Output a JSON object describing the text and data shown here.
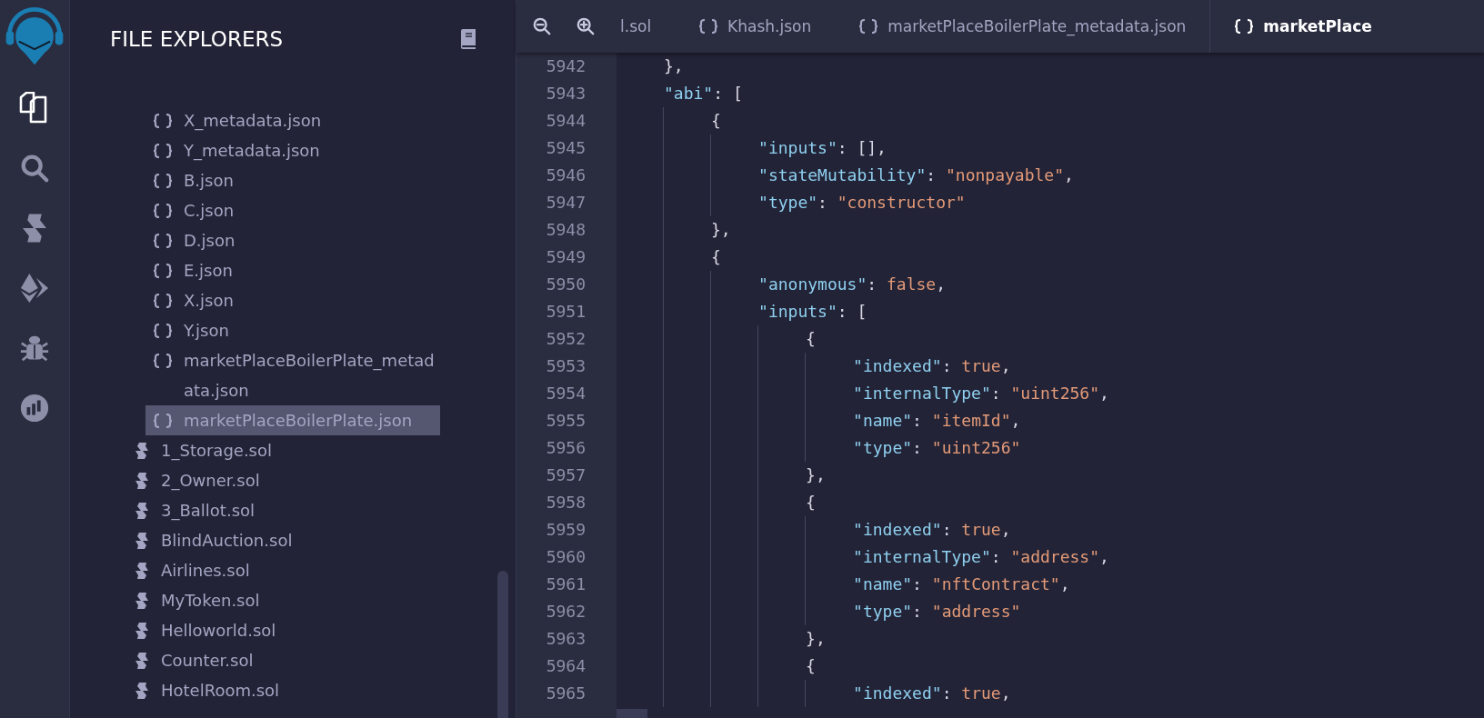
{
  "activity_bar": [
    {
      "kind": "files",
      "selected": true
    },
    {
      "kind": "search",
      "selected": false
    },
    {
      "kind": "solidity",
      "selected": false
    },
    {
      "kind": "deploy",
      "selected": false
    },
    {
      "kind": "debug",
      "selected": false
    },
    {
      "kind": "analytics",
      "selected": false
    }
  ],
  "sidebar": {
    "title": "FILE EXPLORERS",
    "artifact_files": [
      {
        "name": "X_metadata.json",
        "kind": "json",
        "selected": false
      },
      {
        "name": "Y_metadata.json",
        "kind": "json",
        "selected": false
      },
      {
        "name": "B.json",
        "kind": "json",
        "selected": false
      },
      {
        "name": "C.json",
        "kind": "json",
        "selected": false
      },
      {
        "name": "D.json",
        "kind": "json",
        "selected": false
      },
      {
        "name": "E.json",
        "kind": "json",
        "selected": false
      },
      {
        "name": "X.json",
        "kind": "json",
        "selected": false
      },
      {
        "name": "Y.json",
        "kind": "json",
        "selected": false
      },
      {
        "name": "marketPlaceBoilerPlate_metadata.json",
        "kind": "json",
        "selected": false
      },
      {
        "name": "marketPlaceBoilerPlate.json",
        "kind": "json",
        "selected": true
      }
    ],
    "files": [
      {
        "name": "1_Storage.sol",
        "kind": "sol",
        "selected": false
      },
      {
        "name": "2_Owner.sol",
        "kind": "sol",
        "selected": false
      },
      {
        "name": "3_Ballot.sol",
        "kind": "sol",
        "selected": false
      },
      {
        "name": "BlindAuction.sol",
        "kind": "sol",
        "selected": false
      },
      {
        "name": "Airlines.sol",
        "kind": "sol",
        "selected": false
      },
      {
        "name": "MyToken.sol",
        "kind": "sol",
        "selected": false
      },
      {
        "name": "Helloworld.sol",
        "kind": "sol",
        "selected": false
      },
      {
        "name": "Counter.sol",
        "kind": "sol",
        "selected": false
      },
      {
        "name": "HotelRoom.sol",
        "kind": "sol",
        "selected": false
      }
    ]
  },
  "tabs": [
    {
      "label": "l.sol",
      "kind": "sol",
      "selected": false
    },
    {
      "label": "Khash.json",
      "kind": "json",
      "selected": false
    },
    {
      "label": "marketPlaceBoilerPlate_metadata.json",
      "kind": "json",
      "selected": false
    },
    {
      "label": "marketPlace",
      "kind": "json",
      "selected": true
    }
  ],
  "editor": {
    "lines": [
      {
        "num": "5942",
        "tokens": [
          {
            "kind": "punct",
            "text": "},"
          }
        ]
      },
      {
        "num": "5943",
        "tokens": [
          {
            "kind": "key",
            "text": "\"abi\""
          },
          {
            "kind": "punct",
            "text": ": ["
          }
        ],
        "children": [
          {
            "num": "5944",
            "tokens": [
              {
                "kind": "punct",
                "text": "{"
              }
            ],
            "children": [
              {
                "num": "5945",
                "tokens": [
                  {
                    "kind": "key",
                    "text": "\"inputs\""
                  },
                  {
                    "kind": "punct",
                    "text": ": [],"
                  }
                ]
              },
              {
                "num": "5946",
                "tokens": [
                  {
                    "kind": "key",
                    "text": "\"stateMutability\""
                  },
                  {
                    "kind": "punct",
                    "text": ": "
                  },
                  {
                    "kind": "string",
                    "text": "\"nonpayable\""
                  },
                  {
                    "kind": "punct",
                    "text": ","
                  }
                ]
              },
              {
                "num": "5947",
                "tokens": [
                  {
                    "kind": "key",
                    "text": "\"type\""
                  },
                  {
                    "kind": "punct",
                    "text": ": "
                  },
                  {
                    "kind": "string",
                    "text": "\"constructor\""
                  }
                ]
              }
            ]
          },
          {
            "num": "5948",
            "tokens": [
              {
                "kind": "punct",
                "text": "},"
              }
            ]
          },
          {
            "num": "5949",
            "tokens": [
              {
                "kind": "punct",
                "text": "{"
              }
            ],
            "children": [
              {
                "num": "5950",
                "tokens": [
                  {
                    "kind": "key",
                    "text": "\"anonymous\""
                  },
                  {
                    "kind": "punct",
                    "text": ": "
                  },
                  {
                    "kind": "literal",
                    "text": "false"
                  },
                  {
                    "kind": "punct",
                    "text": ","
                  }
                ]
              },
              {
                "num": "5951",
                "tokens": [
                  {
                    "kind": "key",
                    "text": "\"inputs\""
                  },
                  {
                    "kind": "punct",
                    "text": ": ["
                  }
                ],
                "children": [
                  {
                    "num": "5952",
                    "tokens": [
                      {
                        "kind": "punct",
                        "text": "{"
                      }
                    ],
                    "children": [
                      {
                        "num": "5953",
                        "tokens": [
                          {
                            "kind": "key",
                            "text": "\"indexed\""
                          },
                          {
                            "kind": "punct",
                            "text": ": "
                          },
                          {
                            "kind": "literal",
                            "text": "true"
                          },
                          {
                            "kind": "punct",
                            "text": ","
                          }
                        ]
                      },
                      {
                        "num": "5954",
                        "tokens": [
                          {
                            "kind": "key",
                            "text": "\"internalType\""
                          },
                          {
                            "kind": "punct",
                            "text": ": "
                          },
                          {
                            "kind": "string",
                            "text": "\"uint256\""
                          },
                          {
                            "kind": "punct",
                            "text": ","
                          }
                        ]
                      },
                      {
                        "num": "5955",
                        "tokens": [
                          {
                            "kind": "key",
                            "text": "\"name\""
                          },
                          {
                            "kind": "punct",
                            "text": ": "
                          },
                          {
                            "kind": "string",
                            "text": "\"itemId\""
                          },
                          {
                            "kind": "punct",
                            "text": ","
                          }
                        ]
                      },
                      {
                        "num": "5956",
                        "tokens": [
                          {
                            "kind": "key",
                            "text": "\"type\""
                          },
                          {
                            "kind": "punct",
                            "text": ": "
                          },
                          {
                            "kind": "string",
                            "text": "\"uint256\""
                          }
                        ]
                      }
                    ]
                  },
                  {
                    "num": "5957",
                    "tokens": [
                      {
                        "kind": "punct",
                        "text": "},"
                      }
                    ]
                  },
                  {
                    "num": "5958",
                    "tokens": [
                      {
                        "kind": "punct",
                        "text": "{"
                      }
                    ],
                    "children": [
                      {
                        "num": "5959",
                        "tokens": [
                          {
                            "kind": "key",
                            "text": "\"indexed\""
                          },
                          {
                            "kind": "punct",
                            "text": ": "
                          },
                          {
                            "kind": "literal",
                            "text": "true"
                          },
                          {
                            "kind": "punct",
                            "text": ","
                          }
                        ]
                      },
                      {
                        "num": "5960",
                        "tokens": [
                          {
                            "kind": "key",
                            "text": "\"internalType\""
                          },
                          {
                            "kind": "punct",
                            "text": ": "
                          },
                          {
                            "kind": "string",
                            "text": "\"address\""
                          },
                          {
                            "kind": "punct",
                            "text": ","
                          }
                        ]
                      },
                      {
                        "num": "5961",
                        "tokens": [
                          {
                            "kind": "key",
                            "text": "\"name\""
                          },
                          {
                            "kind": "punct",
                            "text": ": "
                          },
                          {
                            "kind": "string",
                            "text": "\"nftContract\""
                          },
                          {
                            "kind": "punct",
                            "text": ","
                          }
                        ]
                      },
                      {
                        "num": "5962",
                        "tokens": [
                          {
                            "kind": "key",
                            "text": "\"type\""
                          },
                          {
                            "kind": "punct",
                            "text": ": "
                          },
                          {
                            "kind": "string",
                            "text": "\"address\""
                          }
                        ]
                      }
                    ]
                  },
                  {
                    "num": "5963",
                    "tokens": [
                      {
                        "kind": "punct",
                        "text": "},"
                      }
                    ]
                  },
                  {
                    "num": "5964",
                    "tokens": [
                      {
                        "kind": "punct",
                        "text": "{"
                      }
                    ],
                    "children": [
                      {
                        "num": "5965",
                        "tokens": [
                          {
                            "kind": "key",
                            "text": "\"indexed\""
                          },
                          {
                            "kind": "punct",
                            "text": ": "
                          },
                          {
                            "kind": "literal",
                            "text": "true"
                          },
                          {
                            "kind": "punct",
                            "text": ","
                          }
                        ]
                      }
                    ]
                  }
                ]
              }
            ]
          }
        ]
      }
    ]
  }
}
